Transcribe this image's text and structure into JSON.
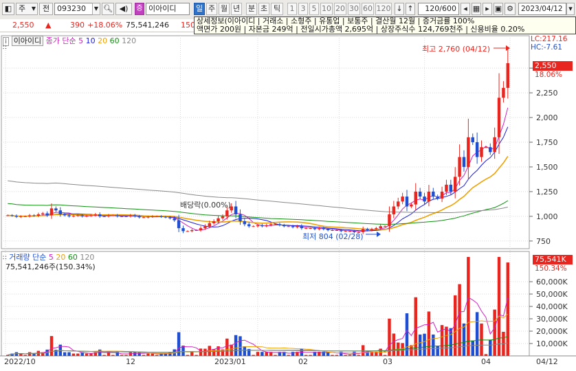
{
  "toolbar": {
    "type_label": "주",
    "scope_label": "전",
    "code_value": "093230",
    "stock_name": "이아이디",
    "badge": "증",
    "periods": [
      "일",
      "주",
      "월",
      "년",
      "분",
      "초",
      "틱"
    ],
    "active_period": "일",
    "intervals": [
      "1",
      "3",
      "5",
      "10",
      "20",
      "30",
      "60",
      "120"
    ],
    "count_value": "120/600",
    "date_value": "2023/04/12"
  },
  "quote": {
    "price": "2,550",
    "change": "390",
    "change_pct": "+18.06%",
    "volume": "75,541,246",
    "extra": "150"
  },
  "tooltip": {
    "line1": "상세정보(이아이디 | 거래소 | 소형주 | 유통업 | 보통주 | 결산월 12월 | 증거금률 100%",
    "line2": "액면가 200원 | 자본금 249억 | 전일시가총액 2,695억 | 상장주식수 124,769천주 | 신용비율 0.20%"
  },
  "price_panel": {
    "tab_label": "이아이디",
    "legend_title": "종가 단순",
    "ma_periods": [
      "5",
      "10",
      "20",
      "60",
      "120"
    ],
    "ma_colors": [
      "#d020c0",
      "#1a1ae0",
      "#f0a000",
      "#109010",
      "#888888"
    ],
    "lc_label": "LC:217.16",
    "hc_label": "HC:-7.61",
    "current_price": "2,550",
    "current_pct": "18.06%",
    "high_annotation": "최고 2,760 (04/12)",
    "low_annotation": "최저 804 (02/28)",
    "dividend_annotation": "배당락(0.00%)",
    "y_ticks": [
      "2,500",
      "2,250",
      "2,000",
      "1,750",
      "1,500",
      "1,250",
      "1,000",
      "750"
    ]
  },
  "volume_panel": {
    "legend_title": "거래량 단순",
    "ma_periods": [
      "5",
      "20",
      "60",
      "120"
    ],
    "ma_colors": [
      "#d020c0",
      "#f0a000",
      "#109010",
      "#888888"
    ],
    "volume_text": "75,541,246주(150.34%)",
    "current_volume": "75,541K",
    "current_pct": "150.34%",
    "y_ticks": [
      "60,000K",
      "50,000K",
      "40,000K",
      "30,000K",
      "20,000K",
      "10,000K"
    ]
  },
  "x_axis": {
    "labels": [
      "2022/10",
      "12",
      "2023/01",
      "02",
      "03",
      "04"
    ],
    "last_label": "04/12"
  },
  "colors": {
    "up": "#e8261f",
    "down": "#1f4fd0",
    "accent": "#2e72c9"
  },
  "chart_data": {
    "type": "candlestick",
    "title": "이아이디",
    "ylim_price": [
      700,
      2800
    ],
    "ylim_volume": [
      0,
      80000
    ],
    "series": [
      {
        "name": "종가",
        "values": [
          1010,
          1005,
          995,
          1000,
          1000,
          1010,
          1005,
          1020,
          1030,
          1010,
          1080,
          1060,
          1020,
          1010,
          1000,
          1005,
          1010,
          1000,
          1005,
          1010,
          1020,
          1000,
          1000,
          1010,
          1010,
          1000,
          1000,
          1000,
          1010,
          1000,
          990,
          990,
          995,
          1000,
          1000,
          995,
          990,
          980,
          960,
          880,
          850,
          850,
          860,
          860,
          880,
          900,
          930,
          950,
          980,
          1000,
          1060,
          1100,
          1020,
          950,
          920,
          900,
          900,
          910,
          900,
          910,
          920,
          920,
          910,
          900,
          900,
          890,
          900,
          880,
          880,
          880,
          870,
          880,
          870,
          860,
          860,
          860,
          850,
          850,
          850,
          840,
          840,
          870,
          860,
          870,
          880,
          900,
          900,
          1020,
          1100,
          1150,
          1200,
          1100,
          1120,
          1250,
          1200,
          1150,
          1250,
          1200,
          1180,
          1250,
          1320,
          1250,
          1400,
          1600,
          1500,
          1800,
          1750,
          1600,
          1700,
          1700,
          1650,
          1800,
          2200,
          2300,
          2550
        ]
      }
    ]
  }
}
